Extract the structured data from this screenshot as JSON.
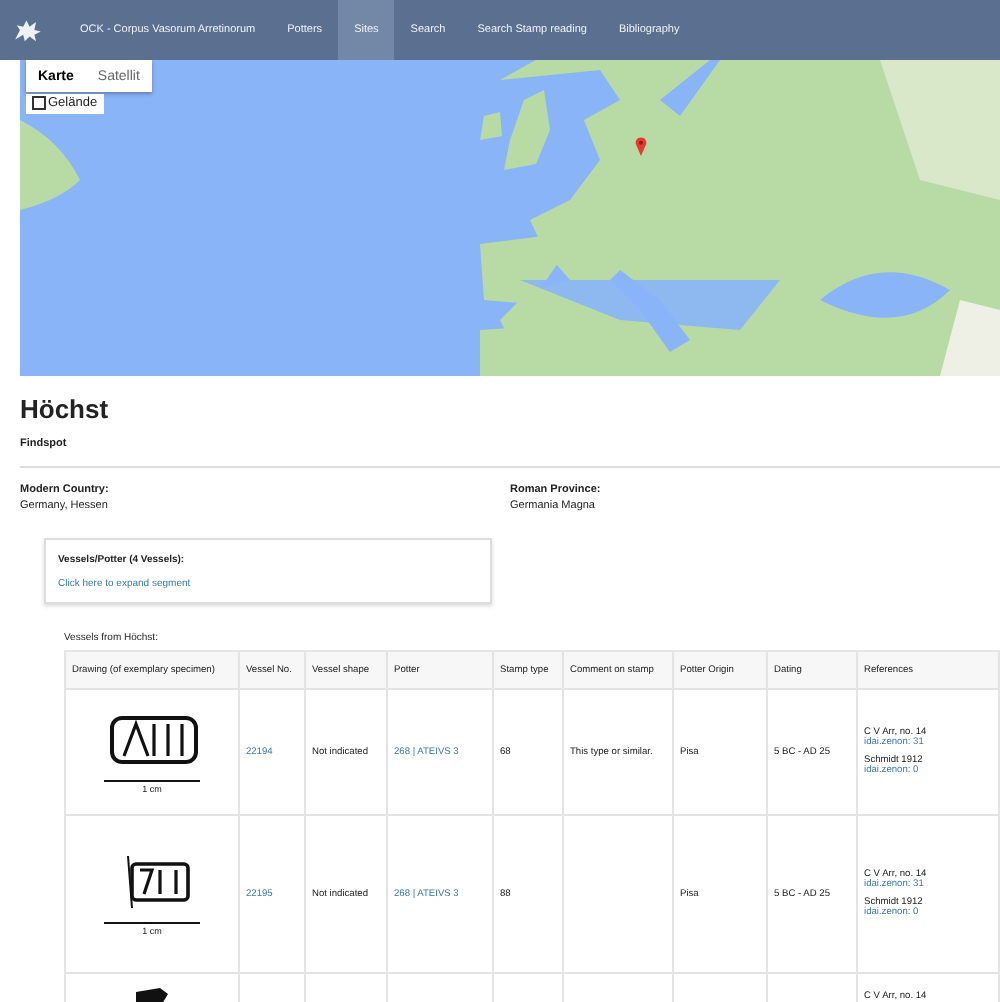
{
  "nav": {
    "items": [
      {
        "label": "OCK - Corpus Vasorum Arretinorum",
        "selected": false
      },
      {
        "label": "Potters",
        "selected": false
      },
      {
        "label": "Sites",
        "selected": true
      },
      {
        "label": "Search",
        "selected": false
      },
      {
        "label": "Search Stamp reading",
        "selected": false
      },
      {
        "label": "Bibliography",
        "selected": false
      }
    ]
  },
  "map": {
    "kind": "picture",
    "map_types": [
      {
        "label": "Karte",
        "selected": true
      },
      {
        "label": "Satellit",
        "selected": false
      }
    ],
    "terrain": {
      "label": "Gelände",
      "checked": false
    }
  },
  "title": "Höchst",
  "subtitle": "Findspot",
  "facts": [
    {
      "label": "Modern Country:",
      "value": "Germany, Hessen"
    },
    {
      "label": "Roman Province:",
      "value": "Germania Magna"
    }
  ],
  "segment": {
    "title": "Vessels/Potter (4 Vessels):",
    "link": "Click here to expand segment"
  },
  "table": {
    "caption": "Vessels from Höchst:",
    "columns": [
      "Drawing (of exemplary specimen)",
      "Vessel No.",
      "Vessel shape",
      "Potter",
      "Stamp type",
      "Comment on stamp",
      "Potter Origin",
      "Dating",
      "References"
    ],
    "rows": [
      {
        "drawing": {
          "kind": "picture",
          "scale": "1 cm"
        },
        "vessel_no": "22194",
        "shape": "Not indicated",
        "potter": "268 | ATEIVS 3",
        "stamp_type": "68",
        "comment": "This type or similar.",
        "origin": "Pisa",
        "dating": "5 BC - AD 25",
        "references": [
          {
            "text": "C V Arr, no. 14",
            "link": "idai.zenon: 31"
          },
          {
            "text": "Schmidt 1912",
            "link": "idai.zenon: 0"
          }
        ]
      },
      {
        "drawing": {
          "kind": "picture",
          "scale": "1 cm"
        },
        "vessel_no": "22195",
        "shape": "Not indicated",
        "potter": "268 | ATEIVS 3",
        "stamp_type": "88",
        "origin": "Pisa",
        "dating": "5 BC - AD 25",
        "references": [
          {
            "text": "C V Arr, no. 14",
            "link": "idai.zenon: 31"
          },
          {
            "text": "Schmidt 1912",
            "link": "idai.zenon: 0"
          }
        ]
      },
      {
        "drawing": {
          "kind": "picture"
        },
        "references": [
          {
            "text": "C V Arr, no. 14"
          }
        ]
      }
    ]
  }
}
